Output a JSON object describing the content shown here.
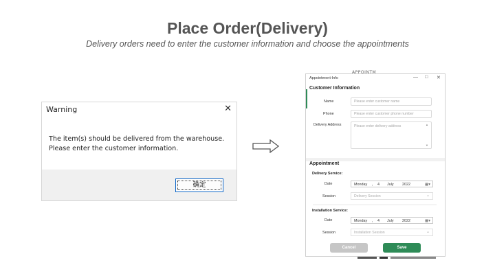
{
  "page": {
    "title": "Place Order(Delivery)",
    "subtitle": "Delivery orders need to enter the customer information and choose the appointments"
  },
  "warning": {
    "title": "Warning",
    "close": "✕",
    "line1": "The item(s) should be delivered from the warehouse.",
    "line2": "Please enter the customer information.",
    "ok_label": "确定"
  },
  "appointment": {
    "background_text": "APPOINTM",
    "window_title": "Appointment-Info",
    "minimize": "—",
    "maximize": "□",
    "close": "✕",
    "customer_heading": "Customer Information",
    "name_label": "Name",
    "name_placeholder": "Please enter customer name",
    "phone_label": "Phone",
    "phone_placeholder": "Please enter customer phone number",
    "address_label": "Delivery Address",
    "address_placeholder": "Please enter delivery address",
    "appointment_heading": "Appointment",
    "delivery_service_label": "Delivery Service:",
    "delivery_date": {
      "label": "Date",
      "weekday": "Monday",
      "sep": ",",
      "day": "4",
      "month": "July",
      "year": "2022",
      "icon": "▦▾"
    },
    "delivery_session": {
      "label": "Session",
      "placeholder": "Delivery Session"
    },
    "installation_service_label": "Installation Service:",
    "installation_date": {
      "label": "Date",
      "weekday": "Monday",
      "sep": ",",
      "day": "4",
      "month": "July",
      "year": "2022",
      "icon": "▦▾"
    },
    "installation_session": {
      "label": "Session",
      "placeholder": "Installation Session"
    },
    "cancel_label": "Cancel",
    "save_label": "Save",
    "accent_color": "#2e8b57"
  }
}
